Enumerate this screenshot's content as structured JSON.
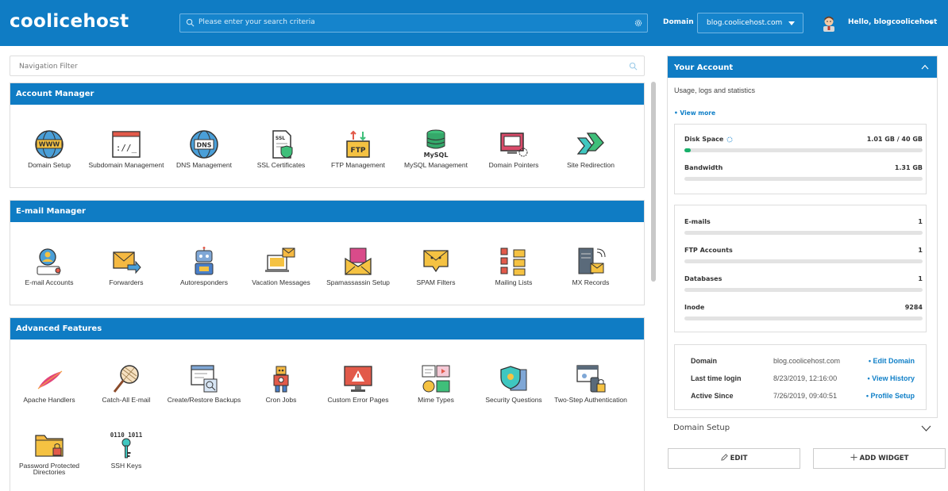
{
  "brand": {
    "logo_text": "coolicehost"
  },
  "header": {
    "search_placeholder": "Please enter your search criteria",
    "domain_label": "Domain",
    "domain_value": "blog.coolicehost.com",
    "greeting": "Hello, blogcoolicehost"
  },
  "nav_filter": {
    "placeholder": "Navigation Filter"
  },
  "sections": {
    "account_manager": {
      "title": "Account Manager",
      "items": [
        "Domain Setup",
        "Subdomain Management",
        "DNS Management",
        "SSL Certificates",
        "FTP Management",
        "MySQL Management",
        "Domain Pointers",
        "Site Redirection"
      ]
    },
    "email_manager": {
      "title": "E-mail Manager",
      "items": [
        "E-mail Accounts",
        "Forwarders",
        "Autoresponders",
        "Vacation Messages",
        "Spamassassin Setup",
        "SPAM Filters",
        "Mailing Lists",
        "MX Records"
      ]
    },
    "advanced_features": {
      "title": "Advanced Features",
      "items": [
        "Apache Handlers",
        "Catch-All E-mail",
        "Create/Restore Backups",
        "Cron Jobs",
        "Custom Error Pages",
        "Mime Types",
        "Security Questions",
        "Two-Step Authentication",
        "Password Protected Directories",
        "SSH Keys"
      ]
    }
  },
  "icon_text": {
    "www": "WWW",
    "dns": "DNS",
    "ssl": "SSL",
    "ftp": "FTP",
    "mysql": "MySQL",
    "cmd": "://_",
    "ssh": "0110 1011"
  },
  "account": {
    "title": "Your Account",
    "subtitle": "Usage, logs and statistics",
    "view_more": "• View more",
    "usage": [
      {
        "name": "Disk Space",
        "value": "1.01 GB / 40 GB",
        "fraction": 0.025
      },
      {
        "name": "Bandwidth",
        "value": "1.31 GB",
        "fraction": 0
      }
    ],
    "counts": [
      {
        "name": "E-mails",
        "value": "1"
      },
      {
        "name": "FTP Accounts",
        "value": "1"
      },
      {
        "name": "Databases",
        "value": "1"
      },
      {
        "name": "Inode",
        "value": "9284"
      }
    ],
    "info": [
      {
        "key": "Domain",
        "value": "blog.coolicehost.com",
        "action": "• Edit Domain"
      },
      {
        "key": "Last time login",
        "value": "8/23/2019, 12:16:00",
        "action": "• View History"
      },
      {
        "key": "Active Since",
        "value": "7/26/2019, 09:40:51",
        "action": "• Profile Setup"
      }
    ]
  },
  "domain_setup_collapsed": "Domain Setup",
  "buttons": {
    "edit": "EDIT",
    "add_widget": "ADD WIDGET"
  },
  "colors": {
    "primary": "#0f7cc4",
    "progress": "#18b06a",
    "link": "#1180c8"
  }
}
